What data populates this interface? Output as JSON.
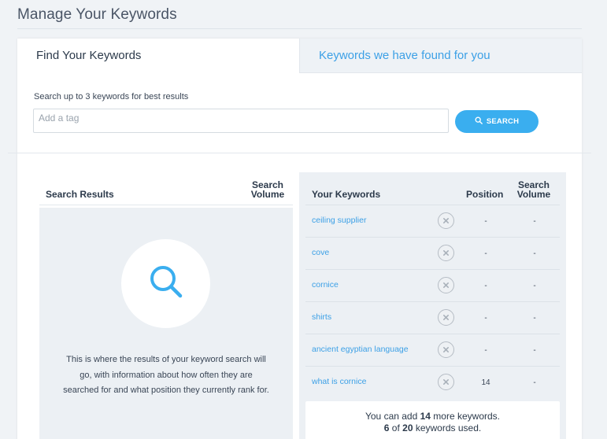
{
  "page": {
    "title": "Manage Your Keywords"
  },
  "tabs": [
    {
      "label": "Find Your Keywords",
      "active": true
    },
    {
      "label": "Keywords we have found for you",
      "active": false
    }
  ],
  "search": {
    "help_text": "Search up to 3 keywords for best results",
    "placeholder": "Add a tag",
    "value": "",
    "button_label": "SEARCH",
    "button_icon": "search-icon"
  },
  "results": {
    "header_label": "Search Results",
    "header_volume": "Search Volume",
    "empty_icon": "search-icon",
    "empty_text": "This is where the results of your keyword search will go, with information about how often they are searched for and what position they currently rank for."
  },
  "keywords": {
    "header_label": "Your Keywords",
    "header_position": "Position",
    "header_volume": "Search Volume",
    "remove_icon": "close-circle-icon",
    "rows": [
      {
        "keyword": "ceiling supplier",
        "position": "-",
        "volume": "-"
      },
      {
        "keyword": "cove",
        "position": "-",
        "volume": "-"
      },
      {
        "keyword": "cornice",
        "position": "-",
        "volume": "-"
      },
      {
        "keyword": "shirts",
        "position": "-",
        "volume": "-"
      },
      {
        "keyword": "ancient egyptian language",
        "position": "-",
        "volume": "-"
      },
      {
        "keyword": "what is cornice",
        "position": "14",
        "volume": "-"
      }
    ],
    "summary": {
      "line1_prefix": "You can add ",
      "remaining": "14",
      "line1_suffix": " more keywords.",
      "used": "6",
      "line2_mid": " of ",
      "limit": "20",
      "line2_suffix": " keywords used."
    }
  },
  "colors": {
    "accent": "#3aaeef",
    "link": "#3ca0e6",
    "panel": "#ecf0f4",
    "page_bg": "#f0f3f6"
  }
}
